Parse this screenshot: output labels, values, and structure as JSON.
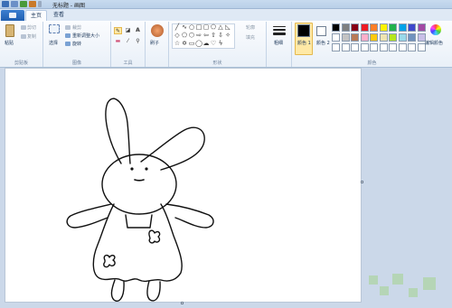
{
  "window": {
    "title": "无标题 - 画图"
  },
  "tabs": [
    {
      "label": "主页",
      "active": true
    },
    {
      "label": "查看",
      "active": false
    }
  ],
  "ribbon": {
    "clipboard": {
      "paste": "粘贴",
      "cut": "剪切",
      "copy": "复制",
      "label": "剪贴板"
    },
    "image": {
      "select": "选择",
      "crop": "裁剪",
      "resize": "重新调整大小",
      "rotate": "旋转",
      "label": "图像"
    },
    "tools": {
      "label": "工具"
    },
    "brushes": {
      "label": "刷子"
    },
    "shapes": {
      "outline": "轮廓",
      "fill": "填充",
      "label": "形状"
    },
    "size": {
      "label": "粗细"
    },
    "colors": {
      "color1": "颜色 1",
      "color2": "颜色 2",
      "edit": "编辑颜色",
      "label": "颜色"
    }
  },
  "palette": {
    "color1": "#000000",
    "color2": "#ffffff",
    "row1": [
      "#000000",
      "#7f7f7f",
      "#880015",
      "#ed1c24",
      "#ff7f27",
      "#fff200",
      "#22b14c",
      "#00a2e8",
      "#3f48cc",
      "#a349a4"
    ],
    "row2": [
      "#ffffff",
      "#c3c3c3",
      "#b97a57",
      "#ffaec9",
      "#ffc90e",
      "#efe4b0",
      "#b5e61d",
      "#99d9ea",
      "#7092be",
      "#c8bfe7"
    ],
    "row3": [
      "#ffffff",
      "#ffffff",
      "#ffffff",
      "#ffffff",
      "#ffffff",
      "#ffffff",
      "#ffffff",
      "#ffffff",
      "#ffffff",
      "#ffffff"
    ]
  }
}
